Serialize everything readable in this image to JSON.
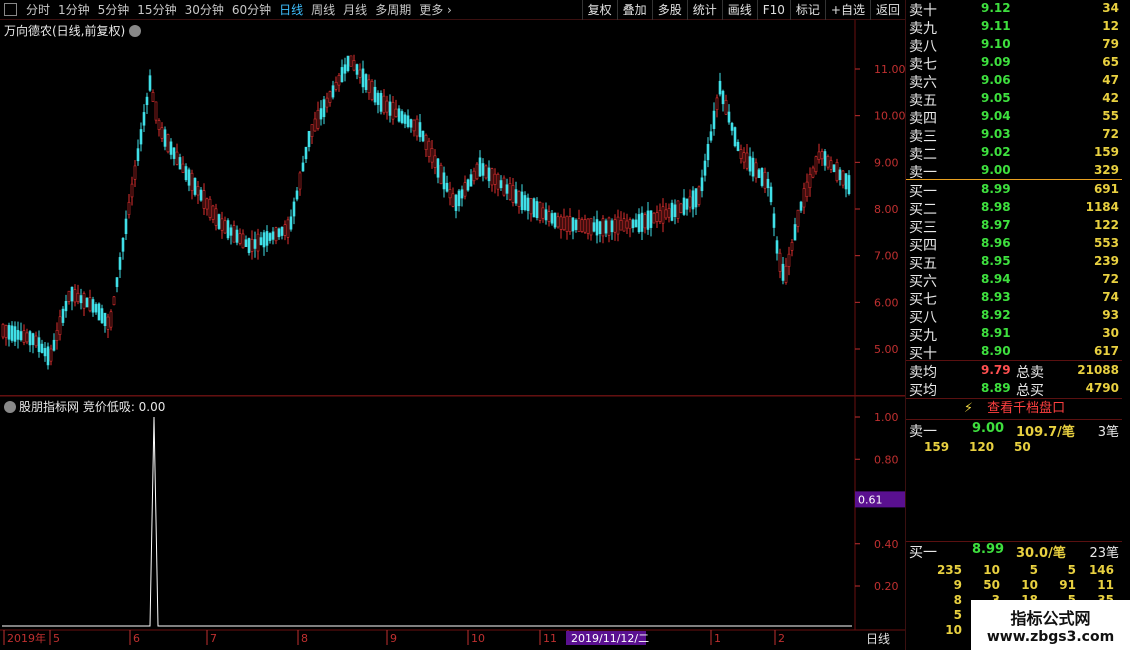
{
  "periods": [
    "分时",
    "1分钟",
    "5分钟",
    "15分钟",
    "30分钟",
    "60分钟",
    "日线",
    "周线",
    "月线",
    "多周期",
    "更多"
  ],
  "active_period": "日线",
  "tools": [
    "复权",
    "叠加",
    "多股",
    "统计",
    "画线",
    "F10",
    "标记",
    "+自选",
    "返回"
  ],
  "main_title": "万向德农(日线,前复权)",
  "sub_title": "股朋指标网 竞价低吸: 0.00",
  "price_axis": [
    "11.00",
    "10.00",
    "9.00",
    "8.00",
    "7.00",
    "6.00",
    "5.00"
  ],
  "ind_axis": [
    "1.00",
    "0.80",
    "0.60",
    "0.40",
    "0.20"
  ],
  "ind_cursor_value": "0.61",
  "x_labels": [
    "2019年",
    "5",
    "6",
    "7",
    "8",
    "9",
    "10",
    "11",
    "2019/11/12/二",
    "1",
    "2"
  ],
  "period_label": "日线",
  "sells": [
    {
      "label": "卖十",
      "price": "9.12",
      "vol": "34"
    },
    {
      "label": "卖九",
      "price": "9.11",
      "vol": "12"
    },
    {
      "label": "卖八",
      "price": "9.10",
      "vol": "79"
    },
    {
      "label": "卖七",
      "price": "9.09",
      "vol": "65"
    },
    {
      "label": "卖六",
      "price": "9.06",
      "vol": "47"
    },
    {
      "label": "卖五",
      "price": "9.05",
      "vol": "42"
    },
    {
      "label": "卖四",
      "price": "9.04",
      "vol": "55"
    },
    {
      "label": "卖三",
      "price": "9.03",
      "vol": "72"
    },
    {
      "label": "卖二",
      "price": "9.02",
      "vol": "159"
    },
    {
      "label": "卖一",
      "price": "9.00",
      "vol": "329"
    }
  ],
  "buys": [
    {
      "label": "买一",
      "price": "8.99",
      "vol": "691"
    },
    {
      "label": "买二",
      "price": "8.98",
      "vol": "1184"
    },
    {
      "label": "买三",
      "price": "8.97",
      "vol": "122"
    },
    {
      "label": "买四",
      "price": "8.96",
      "vol": "553"
    },
    {
      "label": "买五",
      "price": "8.95",
      "vol": "239"
    },
    {
      "label": "买六",
      "price": "8.94",
      "vol": "72"
    },
    {
      "label": "买七",
      "price": "8.93",
      "vol": "74"
    },
    {
      "label": "买八",
      "price": "8.92",
      "vol": "93"
    },
    {
      "label": "买九",
      "price": "8.91",
      "vol": "30"
    },
    {
      "label": "买十",
      "price": "8.90",
      "vol": "617"
    }
  ],
  "sell_avg": {
    "label": "卖均",
    "price": "9.79",
    "total_label": "总卖",
    "total": "21088"
  },
  "buy_avg": {
    "label": "买均",
    "price": "8.89",
    "total_label": "总买",
    "total": "4790"
  },
  "queue_link": "查看千档盘口",
  "sell1_detail": {
    "label": "卖一",
    "price": "9.00",
    "per": "109.7/笔",
    "count": "3笔",
    "orders": [
      "159",
      "120",
      "50"
    ]
  },
  "buy1_detail": {
    "label": "买一",
    "price": "8.99",
    "per": "30.0/笔",
    "count": "23笔",
    "orders": [
      [
        "235",
        "10",
        "5",
        "5",
        "146"
      ],
      [
        "9",
        "50",
        "10",
        "91",
        "11"
      ],
      [
        "8",
        "3",
        "18",
        "5",
        "35"
      ],
      [
        "5",
        "",
        "",
        "",
        ""
      ],
      [
        "10",
        "",
        "",
        "",
        ""
      ]
    ]
  },
  "watermark": {
    "title": "指标公式网",
    "url": "www.zbgs3.com"
  },
  "colors": {
    "up": "#e03030",
    "down": "#40e0e8",
    "price": "#3ee03e",
    "volume": "#e8d040",
    "axis": "#c03030"
  }
}
